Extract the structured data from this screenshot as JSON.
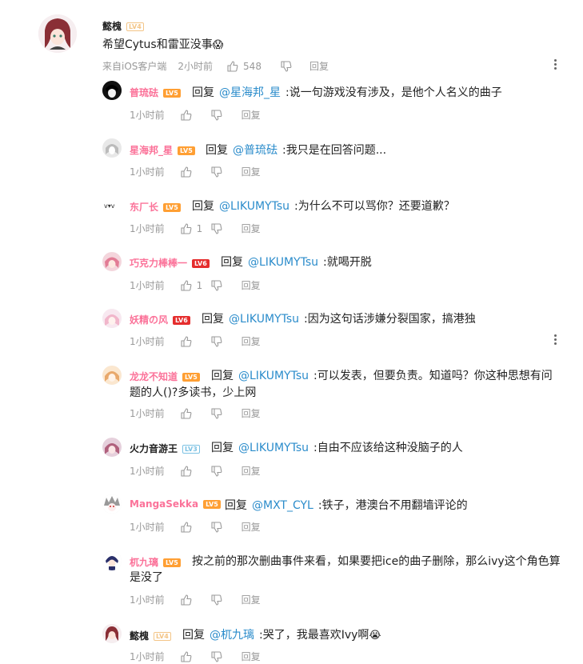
{
  "main_comment": {
    "username": "懿槐",
    "level": "LV4",
    "text": "希望Cytus和雷亚没事",
    "emoji": "😱",
    "source": "来自iOS客户端",
    "time": "2小时前",
    "likes": "548",
    "reply_label": "回复"
  },
  "replies": [
    {
      "username": "普琉砝",
      "level": "LV5",
      "reply_kw": "回复",
      "at": "@星海邦_星",
      "text": ":说一句游戏没有涉及，是他个人名义的曲子",
      "time": "1小时前",
      "likes": "",
      "reply_label": "回复"
    },
    {
      "username": "星海邦_星",
      "level": "LV5",
      "reply_kw": "回复",
      "at": "@普琉砝",
      "text": ":我只是在回答问题...",
      "time": "1小时前",
      "likes": "",
      "reply_label": "回复"
    },
    {
      "username": "东厂长",
      "level": "LV5",
      "reply_kw": "回复",
      "at": "@LIKUMYTsu",
      "text": ":为什么不可以骂你？还要道歉？",
      "time": "1小时前",
      "likes": "1",
      "reply_label": "回复"
    },
    {
      "username": "巧克力棒棒一",
      "level": "LV6",
      "reply_kw": "回复",
      "at": "@LIKUMYTsu",
      "text": ":就喝开脱",
      "time": "1小时前",
      "likes": "1",
      "reply_label": "回复"
    },
    {
      "username": "妖精の风",
      "level": "LV6",
      "reply_kw": "回复",
      "at": "@LIKUMYTsu",
      "text": ":因为这句话涉嫌分裂国家，搞港独",
      "time": "1小时前",
      "likes": "",
      "reply_label": "回复"
    },
    {
      "username": "龙龙不知道",
      "level": "LV5",
      "reply_kw": "回复",
      "at": "@LIKUMYTsu",
      "text": ":可以发表，但要负责。知道吗？你这种思想有问",
      "text2": "题的人()?多读书，少上网",
      "time": "1小时前",
      "likes": "",
      "reply_label": "回复"
    },
    {
      "username": "火力音游王",
      "level": "LV3",
      "reply_kw": "回复",
      "at": "@LIKUMYTsu",
      "text": ":自由不应该给这种没脑子的人",
      "time": "1小时前",
      "likes": "",
      "reply_label": "回复"
    },
    {
      "username": "MangaSekka",
      "level": "LV5",
      "reply_kw": "回复",
      "at": "@MXT_CYL",
      "text": ":铁子，港澳台不用翻墙评论的",
      "time": "1小时前",
      "likes": "",
      "reply_label": "回复"
    },
    {
      "username": "杌九璃",
      "level": "LV5",
      "reply_kw": "",
      "at": "",
      "text": "按之前的那次删曲事件来看，如果要把ice的曲子删除，那么ivy这个角色算",
      "text2": "是没了",
      "time": "1小时前",
      "likes": "",
      "reply_label": "回复"
    },
    {
      "username": "懿槐",
      "level": "LV4",
      "reply_kw": "回复",
      "at": "@杌九璃",
      "text": ":哭了，我最喜欢Ivy啊",
      "emoji": "😭",
      "time": "1小时前",
      "likes": "",
      "reply_label": "回复"
    }
  ],
  "colors": {
    "username_pink": "#fb7299",
    "username_dark": "#222222",
    "link_blue": "#2b8ccb",
    "meta_gray": "#999999"
  }
}
